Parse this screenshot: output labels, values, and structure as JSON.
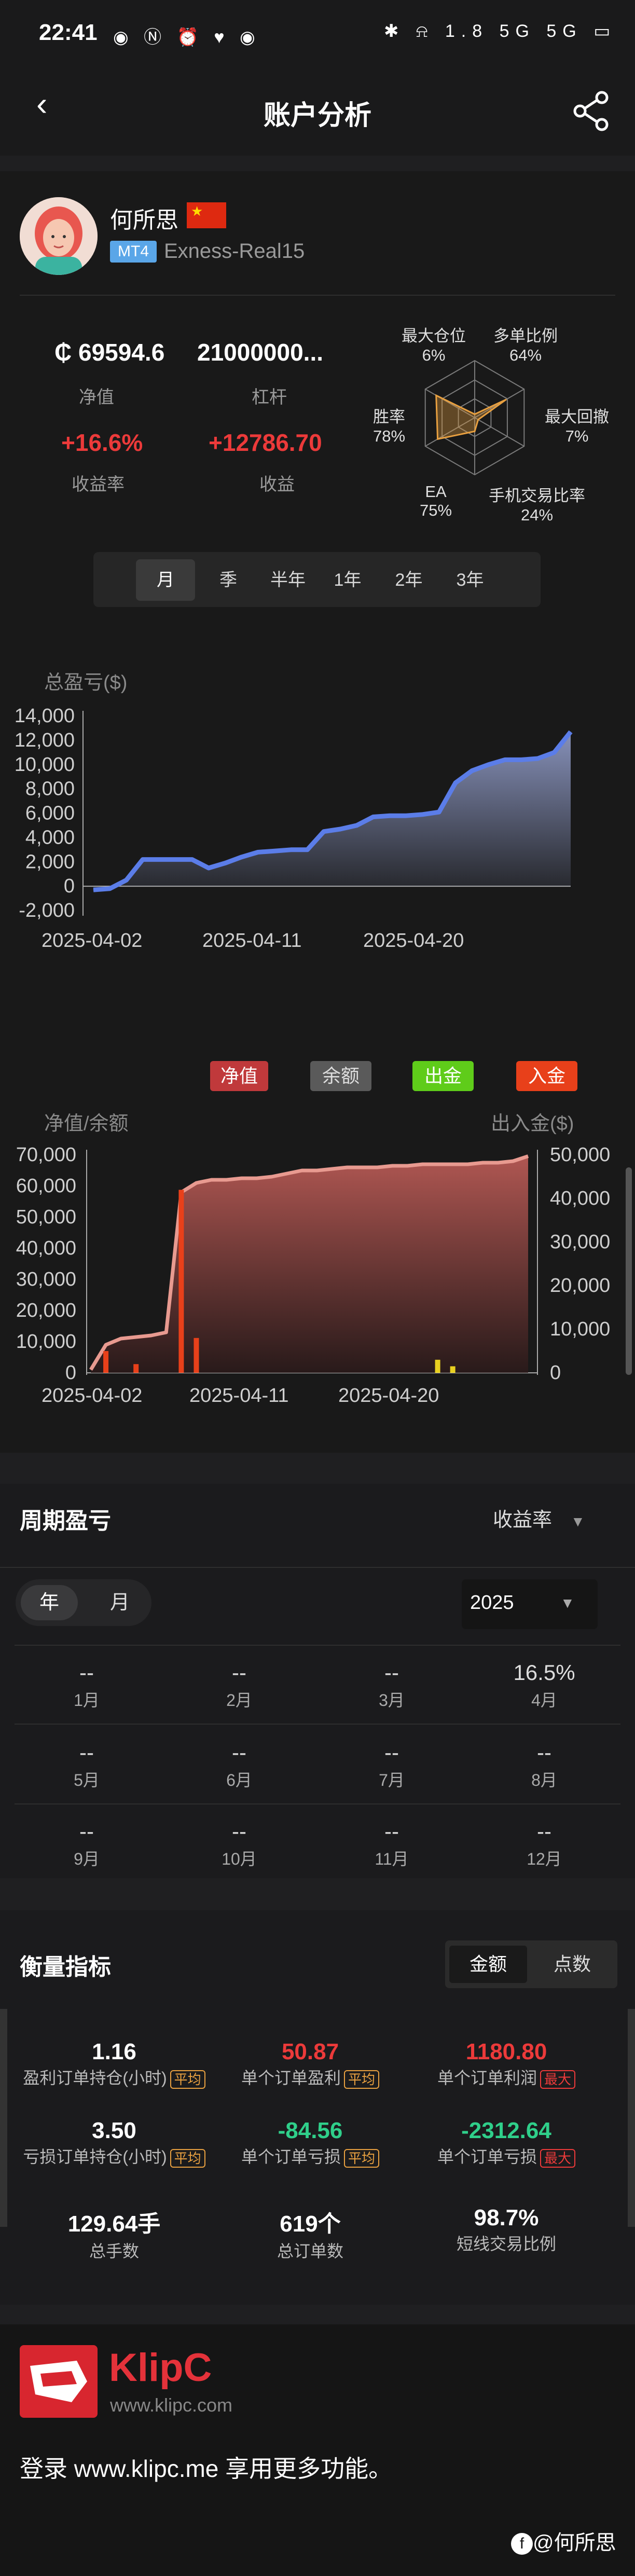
{
  "status_bar": {
    "time": "22:41",
    "left_icons": "◉ Ⓝ ⏰ ♥ ◉",
    "right_icons": "✱ ⍾ 1.8 5G 5G ▭"
  },
  "header": {
    "title": "账户分析",
    "back_icon": "back-arrow-icon",
    "share_icon": "share-icon"
  },
  "profile": {
    "name": "何所思",
    "platform": "MT4",
    "server": "Exness-Real15",
    "flag_symbol": "★"
  },
  "stats": [
    {
      "value": "₵ 69594.6",
      "label": "净值"
    },
    {
      "value": "21000000...",
      "label": "杠杆"
    },
    {
      "value": "+16.6%",
      "label": "收益率"
    },
    {
      "value": "+12786.70",
      "label": "收益"
    }
  ],
  "radar": {
    "labels": [
      {
        "name": "最大仓位",
        "value": "6%"
      },
      {
        "name": "多单比例",
        "value": "64%"
      },
      {
        "name": "最大回撤",
        "value": "7%"
      },
      {
        "name": "手机交易比率",
        "value": "24%"
      },
      {
        "name": "EA",
        "value": "75%"
      },
      {
        "name": "胜率",
        "value": "78%"
      }
    ],
    "fractions": [
      0.06,
      0.64,
      0.07,
      0.24,
      0.75,
      0.78
    ]
  },
  "periods": {
    "items": [
      "月",
      "季",
      "半年",
      "1年",
      "2年",
      "3年"
    ],
    "active": 0
  },
  "colors": {
    "accent_blue": "#5b7de8",
    "red": "#ec3a3a",
    "green": "#2fcf8a",
    "orange": "#e8a040"
  },
  "chart_data": [
    {
      "type": "area",
      "title": "总盈亏($)",
      "x_ticks": [
        "2025-04-02",
        "2025-04-11",
        "2025-04-20"
      ],
      "y_ticks": [
        "14,000",
        "12,000",
        "10,000",
        "8,000",
        "6,000",
        "4,000",
        "2,000",
        "0",
        "-2,000"
      ],
      "ylim": [
        -2000,
        14000
      ],
      "x": [
        0,
        1,
        2,
        3,
        4,
        5,
        6,
        7,
        8,
        9,
        10,
        11,
        12,
        13,
        14,
        15,
        16,
        17,
        18,
        19,
        20,
        21,
        22,
        23,
        24,
        25,
        26,
        27,
        28,
        29
      ],
      "values": [
        -300,
        -200,
        500,
        2200,
        2200,
        2200,
        2200,
        1500,
        1900,
        2400,
        2800,
        2900,
        3000,
        3000,
        4500,
        4700,
        5000,
        5700,
        5800,
        5800,
        5900,
        6100,
        8500,
        9500,
        10000,
        10400,
        10400,
        10500,
        11000,
        12700
      ]
    },
    {
      "type": "area",
      "ylabel": "净值/余额",
      "y2label": "出入金($)",
      "x_ticks": [
        "2025-04-02",
        "2025-04-11",
        "2025-04-20"
      ],
      "y_ticks": [
        "70,000",
        "60,000",
        "50,000",
        "40,000",
        "30,000",
        "20,000",
        "10,000",
        "0"
      ],
      "y2_ticks": [
        "50,000",
        "40,000",
        "30,000",
        "20,000",
        "10,000",
        "0"
      ],
      "ylim": [
        0,
        70000
      ],
      "y2lim": [
        0,
        50000
      ],
      "legend": [
        {
          "name": "净值",
          "color": "#c0393b"
        },
        {
          "name": "余额",
          "color": "#5a5a5a"
        },
        {
          "name": "出金",
          "color": "#5fcc1a"
        },
        {
          "name": "入金",
          "color": "#e8401a"
        }
      ],
      "x": [
        0,
        1,
        2,
        3,
        4,
        5,
        6,
        7,
        8,
        9,
        10,
        11,
        12,
        13,
        14,
        15,
        16,
        17,
        18,
        19,
        20,
        21,
        22,
        23,
        24,
        25,
        26,
        27,
        28,
        29
      ],
      "equity": [
        1000,
        9000,
        11000,
        11500,
        12000,
        13000,
        58000,
        61000,
        62000,
        62000,
        62500,
        62500,
        63000,
        64000,
        65000,
        65000,
        65500,
        66000,
        66000,
        66000,
        66500,
        66500,
        67000,
        67000,
        67000,
        67000,
        67500,
        67500,
        68000,
        69600
      ],
      "deposit_bars": [
        {
          "x": 1,
          "value": 5000
        },
        {
          "x": 3,
          "value": 2000
        },
        {
          "x": 6,
          "value": 42000
        },
        {
          "x": 7,
          "value": 8000
        }
      ],
      "withdraw_bars": [
        {
          "x": 23,
          "value": 3000
        },
        {
          "x": 24,
          "value": 1500
        }
      ]
    }
  ],
  "period_pnl": {
    "title": "周期盈亏",
    "metric": "收益率",
    "toggle": [
      "年",
      "月"
    ],
    "year": "2025",
    "months": [
      {
        "v": "--",
        "m": "1月"
      },
      {
        "v": "--",
        "m": "2月"
      },
      {
        "v": "--",
        "m": "3月"
      },
      {
        "v": "16.5%",
        "m": "4月"
      },
      {
        "v": "--",
        "m": "5月"
      },
      {
        "v": "--",
        "m": "6月"
      },
      {
        "v": "--",
        "m": "7月"
      },
      {
        "v": "--",
        "m": "8月"
      },
      {
        "v": "--",
        "m": "9月"
      },
      {
        "v": "--",
        "m": "10月"
      },
      {
        "v": "--",
        "m": "11月"
      },
      {
        "v": "--",
        "m": "12月"
      }
    ]
  },
  "metrics": {
    "title": "衡量指标",
    "seg": [
      "金额",
      "点数"
    ],
    "items": [
      {
        "value": "1.16",
        "label": "盈利订单持仓(小时)",
        "badge": "平均",
        "tone": "white",
        "bcolor": "#e8a040"
      },
      {
        "value": "50.87",
        "label": "单个订单盈利",
        "badge": "平均",
        "tone": "red",
        "bcolor": "#e8a040"
      },
      {
        "value": "1180.80",
        "label": "单个订单利润",
        "badge": "最大",
        "tone": "red",
        "bcolor": "#ec3a3a"
      },
      {
        "value": "3.50",
        "label": "亏损订单持仓(小时)",
        "badge": "平均",
        "tone": "white",
        "bcolor": "#e8a040"
      },
      {
        "value": "-84.56",
        "label": "单个订单亏损",
        "badge": "平均",
        "tone": "green",
        "bcolor": "#e8a040"
      },
      {
        "value": "-2312.64",
        "label": "单个订单亏损",
        "badge": "最大",
        "tone": "green",
        "bcolor": "#ec3a3a"
      },
      {
        "value": "129.64手",
        "label": "总手数",
        "badge": "",
        "tone": "white",
        "bcolor": ""
      },
      {
        "value": "619个",
        "label": "总订单数",
        "badge": "",
        "tone": "white",
        "bcolor": ""
      },
      {
        "value": "98.7%",
        "label": "短线交易比例",
        "badge": "",
        "tone": "white",
        "bcolor": ""
      }
    ]
  },
  "footer": {
    "brand": "KlipC",
    "site": "www.klipc.com",
    "promo": "登录 www.klipc.me 享用更多功能。",
    "watermark": "@何所思"
  }
}
